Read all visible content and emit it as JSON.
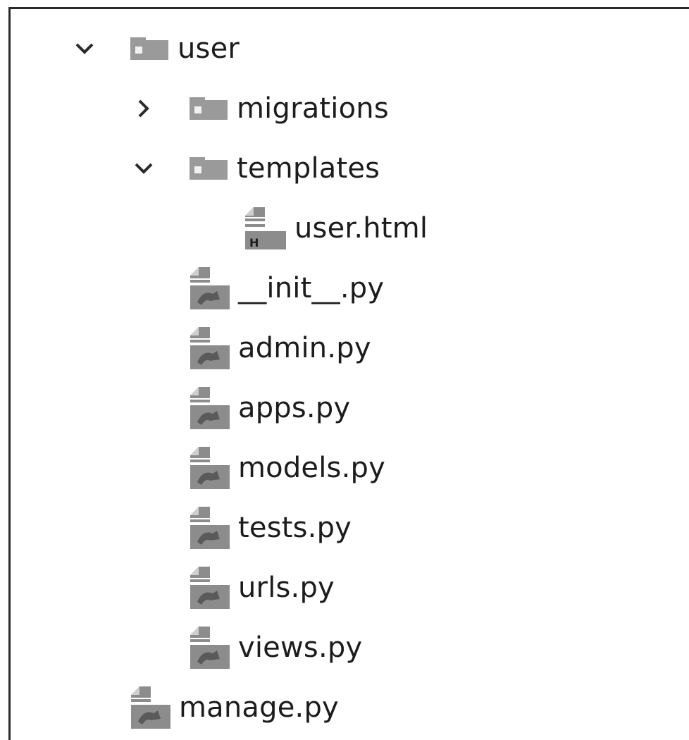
{
  "tree": {
    "root": {
      "label": "user",
      "expanded": true,
      "children": {
        "migrations": {
          "label": "migrations",
          "expanded": false
        },
        "templates": {
          "label": "templates",
          "expanded": true,
          "children": {
            "user_html": {
              "label": "user.html",
              "icon": "html-file-icon"
            }
          }
        },
        "init_py": {
          "label": "__init__.py",
          "icon": "python-file-icon"
        },
        "admin_py": {
          "label": "admin.py",
          "icon": "python-file-icon"
        },
        "apps_py": {
          "label": "apps.py",
          "icon": "python-file-icon"
        },
        "models_py": {
          "label": "models.py",
          "icon": "python-file-icon"
        },
        "tests_py": {
          "label": "tests.py",
          "icon": "python-file-icon"
        },
        "urls_py": {
          "label": "urls.py",
          "icon": "python-file-icon"
        },
        "views_py": {
          "label": "views.py",
          "icon": "python-file-icon"
        }
      }
    },
    "manage_py": {
      "label": "manage.py",
      "icon": "python-file-icon"
    }
  },
  "colors": {
    "text": "#1c1c1c",
    "folder": "#9a9a9a",
    "border": "#2a2a2a"
  }
}
